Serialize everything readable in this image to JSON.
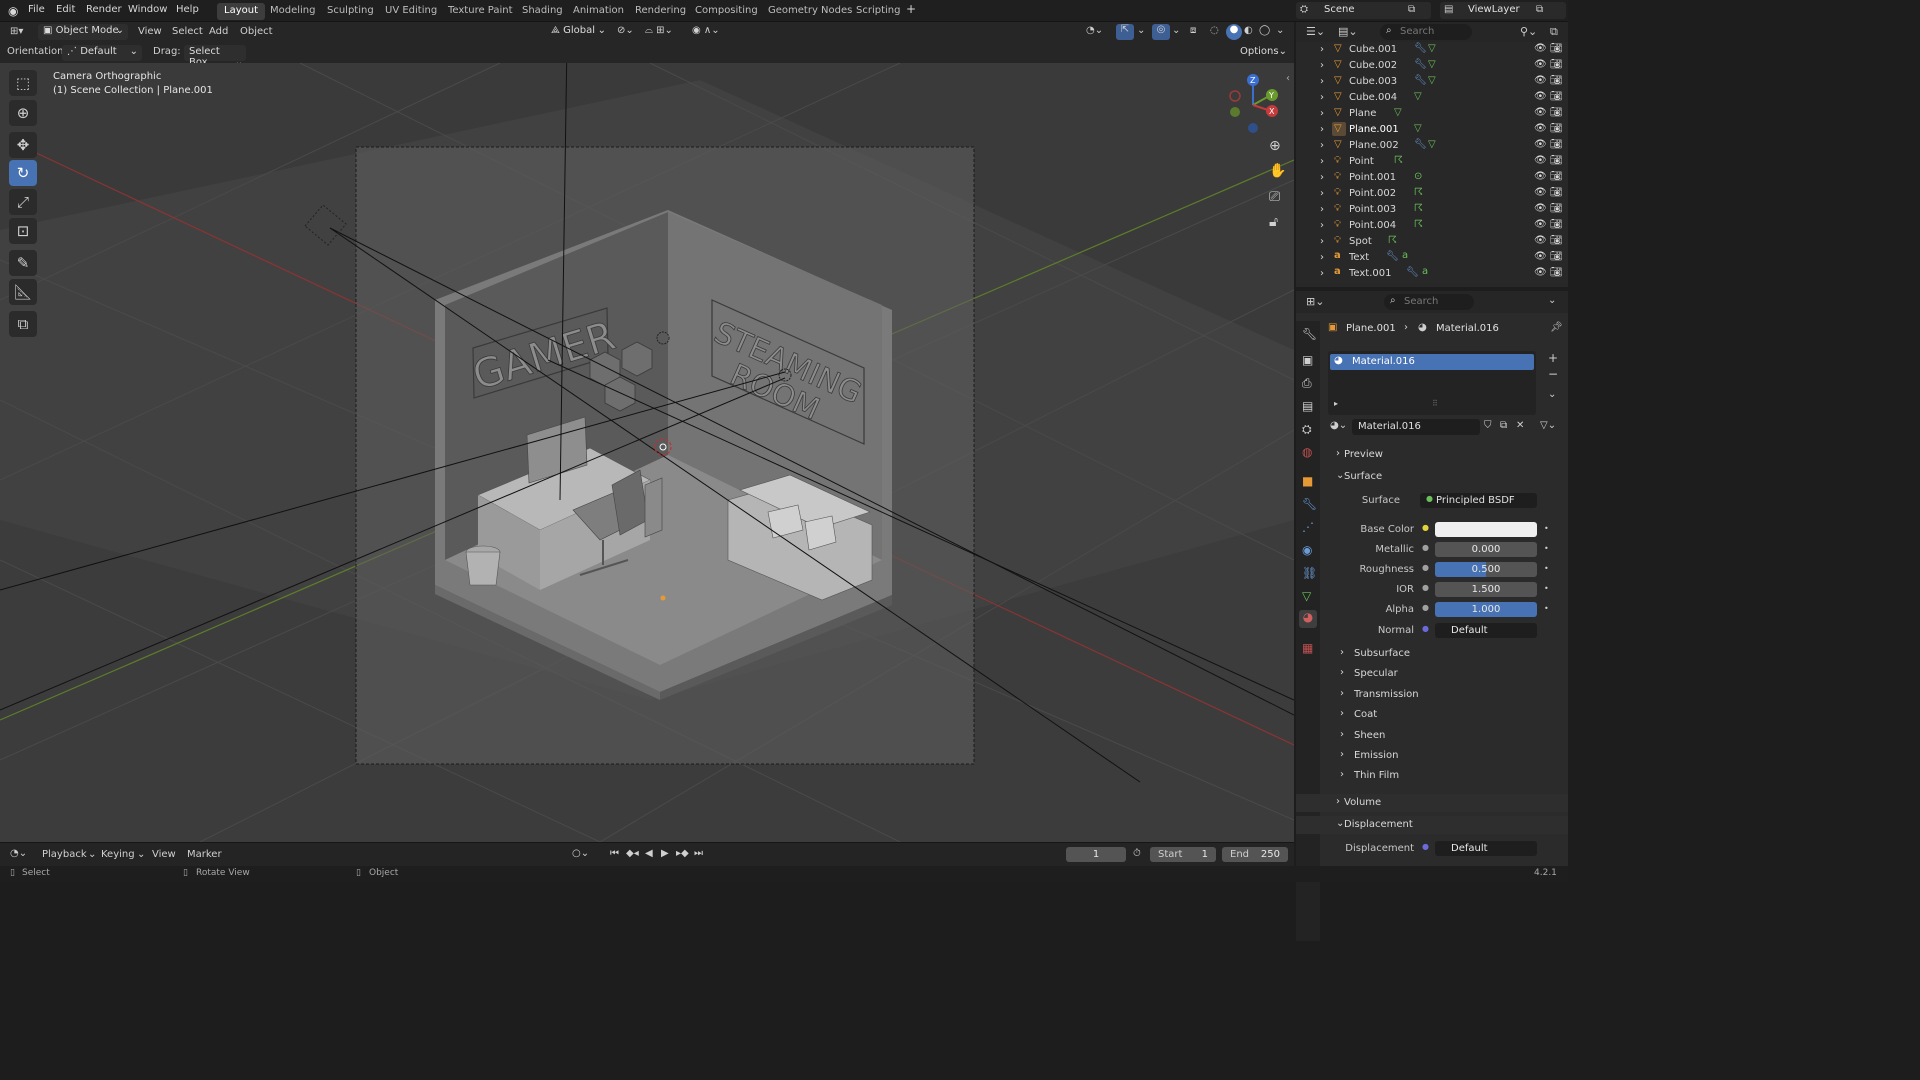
{
  "menu": {
    "file": "File",
    "edit": "Edit",
    "render": "Render",
    "window": "Window",
    "help": "Help"
  },
  "workspaces": [
    "Layout",
    "Modeling",
    "Sculpting",
    "UV Editing",
    "Texture Paint",
    "Shading",
    "Animation",
    "Rendering",
    "Compositing",
    "Geometry Nodes",
    "Scripting"
  ],
  "active_workspace": "Layout",
  "scene_name": "Scene",
  "view_layer": "ViewLayer",
  "header": {
    "mode": "Object Mode",
    "view": "View",
    "select": "Select",
    "add": "Add",
    "object": "Object",
    "transform": "Global",
    "orientation_label": "Orientation:",
    "orientation_value": "Default",
    "drag_label": "Drag:",
    "drag_value": "Select Box",
    "options": "Options"
  },
  "viewport_info": {
    "line1": "Camera Orthographic",
    "line2": "(1) Scene Collection | Plane.001"
  },
  "room_text": {
    "left_sign": "GAMER",
    "right_sign_1": "STEAMING",
    "right_sign_2": "ROOM"
  },
  "outliner": {
    "search_placeholder": "Search",
    "items": [
      "Cube.001",
      "Cube.002",
      "Cube.003",
      "Cube.004",
      "Plane",
      "Plane.001",
      "Plane.002",
      "Point",
      "Point.001",
      "Point.002",
      "Point.003",
      "Point.004",
      "Spot",
      "Text",
      "Text.001"
    ]
  },
  "properties": {
    "search_placeholder": "Search",
    "breadcrumb_object": "Plane.001",
    "breadcrumb_material": "Material.016",
    "slot": "Material.016",
    "material_name": "Material.016",
    "preview": "Preview",
    "surface_section": "Surface",
    "surface_label": "Surface",
    "surface_value": "Principled BSDF",
    "base_color_label": "Base Color",
    "metallic_label": "Metallic",
    "metallic_value": "0.000",
    "roughness_label": "Roughness",
    "roughness_value": "0.500",
    "ior_label": "IOR",
    "ior_value": "1.500",
    "alpha_label": "Alpha",
    "alpha_value": "1.000",
    "normal_label": "Normal",
    "normal_value": "Default",
    "subsections": [
      "Subsurface",
      "Specular",
      "Transmission",
      "Coat",
      "Sheen",
      "Emission",
      "Thin Film"
    ],
    "volume": "Volume",
    "displacement_section": "Displacement",
    "displacement_label": "Displacement",
    "displacement_value": "Default"
  },
  "timeline": {
    "playback": "Playback",
    "keying": "Keying",
    "view": "View",
    "marker": "Marker",
    "current_frame": "1",
    "start_label": "Start",
    "start_value": "1",
    "end_label": "End",
    "end_value": "250"
  },
  "status": {
    "select": "Select",
    "rotate": "Rotate View",
    "object": "Object",
    "version": "4.2.1"
  },
  "colors": {
    "accent": "#4772b3",
    "x_axis": "#c53a3a",
    "y_axis": "#6a9a2e",
    "z_axis": "#3a6fd0",
    "object_orange": "#e59a36"
  }
}
